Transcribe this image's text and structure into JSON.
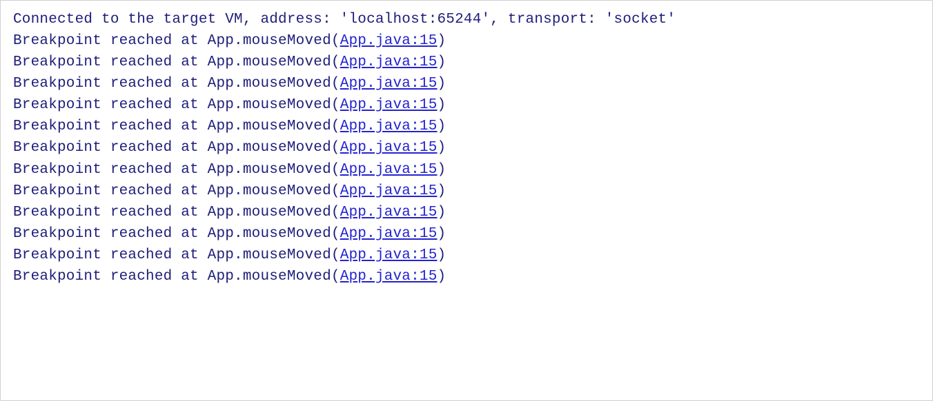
{
  "console": {
    "connection_line": "Connected to the target VM, address: 'localhost:65244', transport: 'socket'",
    "breakpoint_prefix": "Breakpoint reached at App.mouseMoved(",
    "breakpoint_link": "App.java:15",
    "breakpoint_suffix": ")",
    "breakpoint_count": 12
  }
}
